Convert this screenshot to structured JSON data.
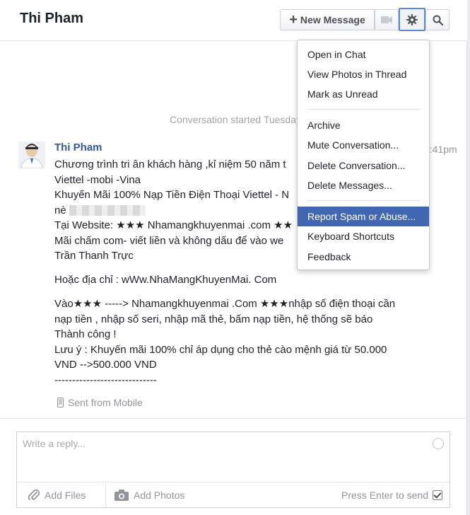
{
  "header": {
    "title": "Thi Pham",
    "new_message": "New Message",
    "icons": {
      "video": "video-camera-icon",
      "gear": "gear-icon",
      "search": "search-icon"
    }
  },
  "conversation": {
    "started": "Conversation started Tuesday",
    "sender": "Thi Pham",
    "time": "5:41pm",
    "lines": [
      "Chương trình tri ân khách hàng ,kỉ niệm 50 năm t",
      "Viettel -mobi -Vina",
      "Khuyến Mãi 100% Nạp Tiền Điện Thoại Viettel - N",
      "nè",
      "Tại Website: ★★★ Nhamangkhuyenmai .com ★★",
      "Mãi chấm com- viết liền và không dấu để vào we",
      "Trần Thanh Trực"
    ],
    "line_address": "Hoặc địa chỉ : wWw.NhaMangKhuyenMai. Com",
    "lines2": [
      "Vào★★★ -----> Nhamangkhuyenmai .Com ★★★nhập số điện thoại cần",
      "nạp tiền , nhập số seri, nhập mã thẻ, bấm nạp tiền, hệ thống sẽ báo",
      "Thành công !",
      "Lưu ý : Khuyến mãi 100%  chỉ áp dụng cho thẻ cào mệnh giá từ 50.000",
      "VND -->500.000 VND",
      "-----------------------------"
    ],
    "sent_from": "Sent from Mobile"
  },
  "reply": {
    "placeholder": "Write a reply...",
    "add_files": "Add Files",
    "add_photos": "Add Photos",
    "press_enter": "Press Enter to send",
    "press_enter_checked": true
  },
  "menu": {
    "items": [
      "Open in Chat",
      "View Photos in Thread",
      "Mark as Unread",
      "Archive",
      "Mute Conversation...",
      "Delete Conversation...",
      "Delete Messages...",
      "Report Spam or Abuse...",
      "Keyboard Shortcuts",
      "Feedback"
    ],
    "highlighted": "Report Spam or Abuse..."
  },
  "colors": {
    "accent": "#4267b2",
    "link": "#365899",
    "gear_focus": "#5b88d6"
  }
}
